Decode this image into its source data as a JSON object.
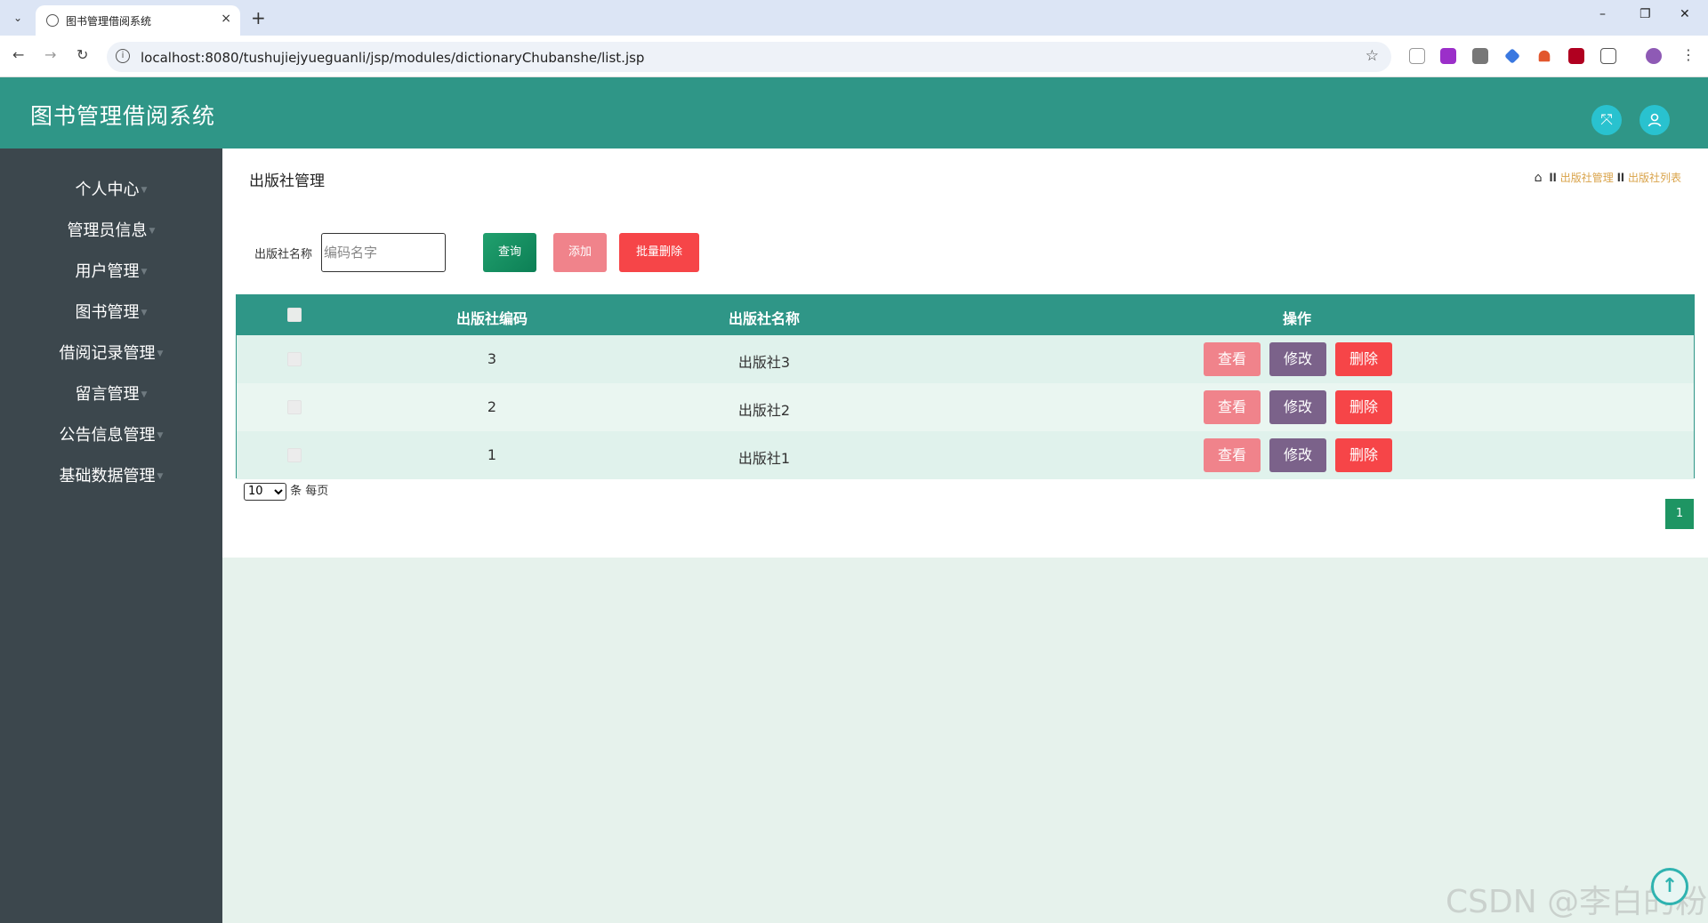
{
  "browser": {
    "tab_title": "图书管理借阅系统",
    "tab_close": "×",
    "new_tab": "+",
    "url": "localhost:8080/tushujiejyueguanli/jsp/modules/dictionaryChubanshe/list.jsp",
    "window_controls": {
      "minimize": "–",
      "restore": "❐",
      "close": "✕"
    },
    "nav": {
      "back": "←",
      "forward": "→",
      "reload": "↻"
    },
    "star": "☆",
    "menu_dots": "⋮"
  },
  "app": {
    "title": "图书管理借阅系统",
    "accent_color": "#2f9687",
    "icons": {
      "fullscreen": "fullscreen-icon",
      "user": "user-icon"
    }
  },
  "sidebar": {
    "items": [
      {
        "label": "个人中心"
      },
      {
        "label": "管理员信息"
      },
      {
        "label": "用户管理"
      },
      {
        "label": "图书管理"
      },
      {
        "label": "借阅记录管理"
      },
      {
        "label": "留言管理"
      },
      {
        "label": "公告信息管理"
      },
      {
        "label": "基础数据管理"
      }
    ]
  },
  "main": {
    "page_title": "出版社管理",
    "breadcrumb": {
      "items": [
        "出版社管理",
        "出版社列表"
      ]
    },
    "search": {
      "label": "出版社名称",
      "placeholder": "编码名字",
      "query_label": "查询",
      "add_label": "添加",
      "batch_delete_label": "批量删除"
    },
    "table": {
      "headers": {
        "code": "出版社编码",
        "name": "出版社名称",
        "actions": "操作"
      },
      "rows": [
        {
          "code": "3",
          "name": "出版社3"
        },
        {
          "code": "2",
          "name": "出版社2"
        },
        {
          "code": "1",
          "name": "出版社1"
        }
      ],
      "row_actions": {
        "view": "查看",
        "edit": "修改",
        "delete": "删除"
      }
    },
    "pager": {
      "page_size": "10",
      "page_size_suffix": "条 每页",
      "current_page": "1"
    }
  },
  "watermark": "CSDN @李白的粉"
}
